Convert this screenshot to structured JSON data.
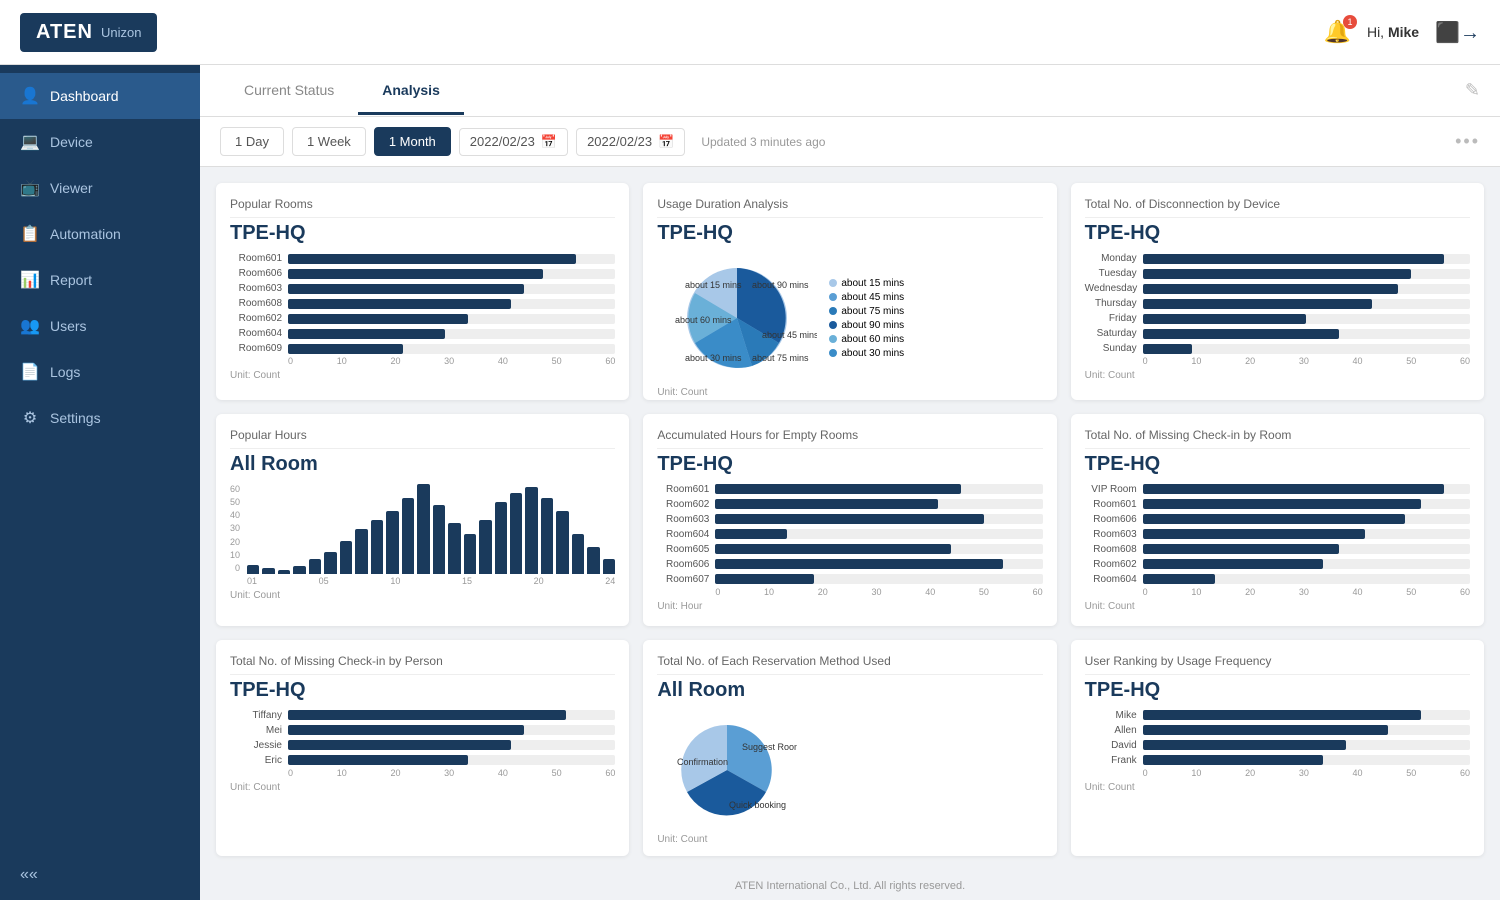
{
  "header": {
    "logo": "ATEN",
    "product": "Unizon",
    "greeting": "Hi,",
    "username": "Mike",
    "bell_badge": "1"
  },
  "sidebar": {
    "items": [
      {
        "id": "dashboard",
        "label": "Dashboard",
        "icon": "👤",
        "active": true
      },
      {
        "id": "device",
        "label": "Device",
        "icon": "🖥"
      },
      {
        "id": "viewer",
        "label": "Viewer",
        "icon": "📺"
      },
      {
        "id": "automation",
        "label": "Automation",
        "icon": "📋"
      },
      {
        "id": "report",
        "label": "Report",
        "icon": "📊"
      },
      {
        "id": "users",
        "label": "Users",
        "icon": "👥"
      },
      {
        "id": "logs",
        "label": "Logs",
        "icon": "📄"
      },
      {
        "id": "settings",
        "label": "Settings",
        "icon": "⚙"
      }
    ],
    "collapse_label": "«"
  },
  "tabs": [
    {
      "id": "current-status",
      "label": "Current Status"
    },
    {
      "id": "analysis",
      "label": "Analysis",
      "active": true
    }
  ],
  "filter": {
    "buttons": [
      "1 Day",
      "1 Week",
      "1 Month"
    ],
    "active_button": "1 Month",
    "date_from": "2022/02/23",
    "date_to": "2022/02/23",
    "updated": "Updated 3 minutes ago"
  },
  "charts": {
    "popular_rooms": {
      "title": "Popular Rooms",
      "subtitle": "TPE-HQ",
      "unit": "Unit: Count",
      "bars": [
        {
          "label": "Room601",
          "pct": 88
        },
        {
          "label": "Room606",
          "pct": 78
        },
        {
          "label": "Room603",
          "pct": 72
        },
        {
          "label": "Room608",
          "pct": 68
        },
        {
          "label": "Room602",
          "pct": 55
        },
        {
          "label": "Room604",
          "pct": 48
        },
        {
          "label": "Room609",
          "pct": 35
        }
      ],
      "axis": [
        "0",
        "10",
        "20",
        "30",
        "40",
        "50",
        "60"
      ]
    },
    "usage_duration": {
      "title": "Usage Duration Analysis",
      "subtitle": "TPE-HQ",
      "unit": "Unit: Count",
      "slices": [
        {
          "label": "about 15 mins",
          "pct": 22,
          "color": "#a8c8e8"
        },
        {
          "label": "about 45 mins",
          "pct": 15,
          "color": "#5a9ed4"
        },
        {
          "label": "about 75 mins",
          "pct": 12,
          "color": "#2a7ab8"
        },
        {
          "label": "about 90 mins",
          "pct": 18,
          "color": "#1a5a9c"
        },
        {
          "label": "about 60 mins",
          "pct": 16,
          "color": "#6ab0d8"
        },
        {
          "label": "about 30 mins",
          "pct": 17,
          "color": "#3a8cc8"
        }
      ]
    },
    "disconnection": {
      "title": "Total No. of Disconnection by Device",
      "subtitle": "TPE-HQ",
      "unit": "Unit: Count",
      "bars": [
        {
          "label": "Monday",
          "pct": 92
        },
        {
          "label": "Tuesday",
          "pct": 82
        },
        {
          "label": "Wednesday",
          "pct": 78
        },
        {
          "label": "Thursday",
          "pct": 70
        },
        {
          "label": "Friday",
          "pct": 50
        },
        {
          "label": "Saturday",
          "pct": 60
        },
        {
          "label": "Sunday",
          "pct": 15
        }
      ],
      "axis": [
        "0",
        "10",
        "20",
        "30",
        "40",
        "50",
        "60"
      ]
    },
    "popular_hours": {
      "title": "Popular Hours",
      "subtitle": "All Room",
      "unit": "Unit: Count",
      "y_axis": [
        "60",
        "50",
        "40",
        "30",
        "20",
        "10",
        "0"
      ],
      "x_axis": [
        "01",
        "05",
        "10",
        "15",
        "20",
        "24"
      ],
      "bars": [
        5,
        3,
        2,
        4,
        8,
        12,
        18,
        25,
        30,
        35,
        42,
        50,
        38,
        28,
        22,
        30,
        40,
        45,
        48,
        42,
        35,
        22,
        15,
        8
      ]
    },
    "empty_rooms": {
      "title": "Accumulated Hours for Empty Rooms",
      "subtitle": "TPE-HQ",
      "unit": "Unit: Hour",
      "bars": [
        {
          "label": "Room601",
          "pct": 75
        },
        {
          "label": "Room602",
          "pct": 68
        },
        {
          "label": "Room603",
          "pct": 82
        },
        {
          "label": "Room604",
          "pct": 22
        },
        {
          "label": "Room605",
          "pct": 72
        },
        {
          "label": "Room606",
          "pct": 88
        },
        {
          "label": "Room607",
          "pct": 30
        }
      ],
      "axis": [
        "0",
        "10",
        "20",
        "30",
        "40",
        "50",
        "60"
      ]
    },
    "missing_checkin_room": {
      "title": "Total No. of Missing Check-in by Room",
      "subtitle": "TPE-HQ",
      "unit": "Unit: Count",
      "bars": [
        {
          "label": "VIP Room",
          "pct": 92
        },
        {
          "label": "Room601",
          "pct": 85
        },
        {
          "label": "Room606",
          "pct": 80
        },
        {
          "label": "Room603",
          "pct": 68
        },
        {
          "label": "Room608",
          "pct": 60
        },
        {
          "label": "Room602",
          "pct": 55
        },
        {
          "label": "Room604",
          "pct": 22
        }
      ],
      "axis": [
        "0",
        "10",
        "20",
        "30",
        "40",
        "50",
        "60"
      ]
    },
    "missing_checkin_person": {
      "title": "Total No. of Missing Check-in by Person",
      "subtitle": "TPE-HQ",
      "unit": "Unit: Count",
      "bars": [
        {
          "label": "Tiffany",
          "pct": 85
        },
        {
          "label": "Mei",
          "pct": 72
        },
        {
          "label": "Jessie",
          "pct": 68
        },
        {
          "label": "Eric",
          "pct": 55
        }
      ],
      "axis": [
        "0",
        "10",
        "20",
        "30",
        "40",
        "50",
        "60"
      ]
    },
    "reservation_method": {
      "title": "Total No. of Each Reservation Method Used",
      "subtitle": "All Room",
      "unit": "Unit: Count",
      "slices": [
        {
          "label": "Suggest Room",
          "pct": 40,
          "color": "#5a9ed4"
        },
        {
          "label": "Quick booking",
          "pct": 35,
          "color": "#1a5a9c"
        },
        {
          "label": "Confirmation",
          "pct": 25,
          "color": "#a8c8e8"
        }
      ]
    },
    "user_ranking": {
      "title": "User Ranking by Usage Frequency",
      "subtitle": "TPE-HQ",
      "unit": "Unit: Count",
      "bars": [
        {
          "label": "Mike",
          "pct": 85
        },
        {
          "label": "Allen",
          "pct": 75
        },
        {
          "label": "David",
          "pct": 62
        },
        {
          "label": "Frank",
          "pct": 55
        }
      ],
      "axis": [
        "0",
        "10",
        "20",
        "30",
        "40",
        "50",
        "60"
      ]
    }
  },
  "footer": {
    "text": "ATEN International Co., Ltd. All rights reserved."
  }
}
